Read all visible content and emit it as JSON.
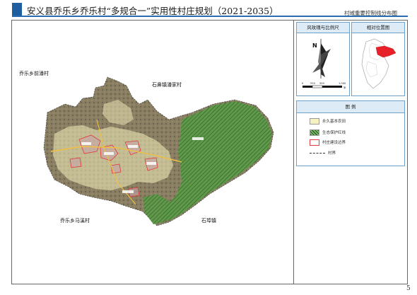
{
  "header": {
    "title": "安义县乔乐乡乔乐村“多规合一”实用性村庄规划（2021-2035）",
    "subtitle": "村域重要控制线分布图"
  },
  "map": {
    "labels": {
      "nw": "乔乐乡前潘村",
      "ne": "石鼻镇潘家村",
      "sw": "乔乐乡马溪村",
      "se": "石埠镇"
    },
    "colors": {
      "farmland": "#f7f2c0",
      "ecology": "#3f8a3a",
      "village_boundary": "#e04040",
      "satellite": "#7a7460"
    }
  },
  "scale_panel": {
    "title": "风玫瑰与比例尺",
    "north": "N",
    "scale_ticks": [
      "0",
      "250",
      "500",
      "",
      "1,000"
    ],
    "unit": "米"
  },
  "location_panel": {
    "title": "相对位置图"
  },
  "legend": {
    "title": "图    例",
    "items": [
      {
        "label": "永久基本农田",
        "icon": "farmland-swatch"
      },
      {
        "label": "生态保护红线",
        "icon": "ecology-hatch-swatch"
      },
      {
        "label": "村庄建设边界",
        "icon": "village-boundary-swatch"
      },
      {
        "label": "村界",
        "icon": "village-border-line"
      }
    ]
  },
  "page": {
    "number": "5"
  }
}
